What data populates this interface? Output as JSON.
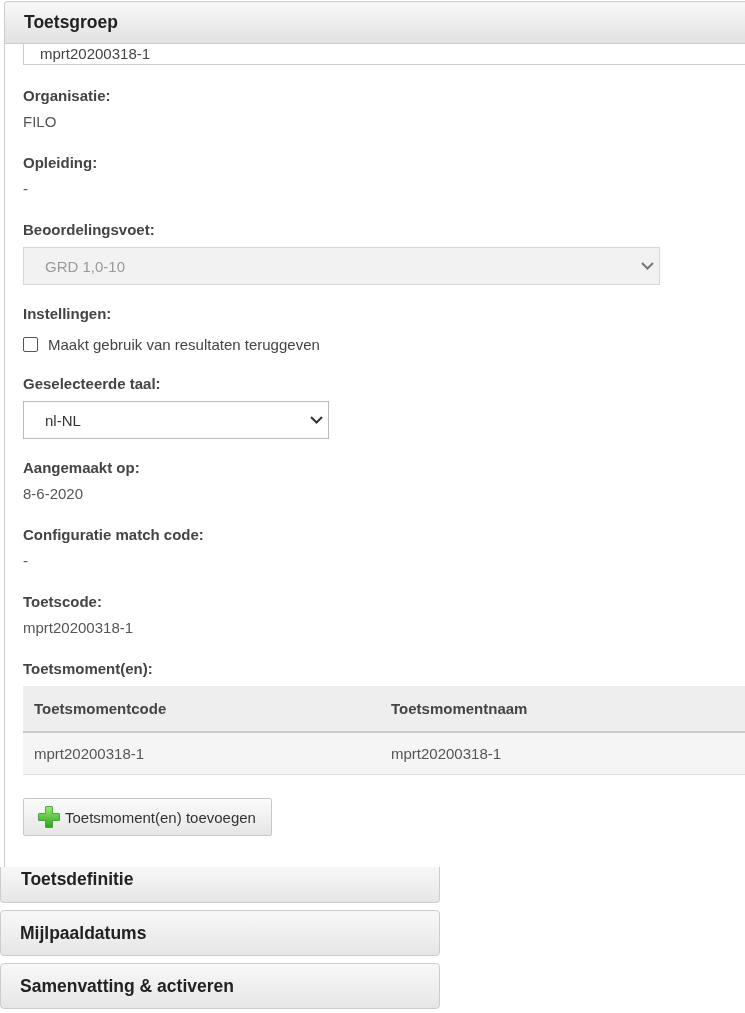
{
  "panel": {
    "title": "Toetsgroep",
    "name_field": {
      "value": "mprt20200318-1"
    },
    "fields": [
      {
        "kind": "text",
        "label": "Organisatie:",
        "value": "FILO"
      },
      {
        "kind": "text",
        "label": "Opleiding:",
        "value": "-"
      },
      {
        "kind": "select",
        "label": "Beoordelingsvoet:",
        "value": "GRD 1,0-10",
        "disabled": true
      },
      {
        "kind": "checkbox",
        "label": "Instellingen:",
        "option": "Maakt gebruik van resultaten teruggeven",
        "checked": false
      },
      {
        "kind": "select",
        "label": "Geselecteerde taal:",
        "value": "nl-NL",
        "disabled": false
      },
      {
        "kind": "text",
        "label": "Aangemaakt op:",
        "value": "8-6-2020"
      },
      {
        "kind": "text",
        "label": "Configuratie match code:",
        "value": "-"
      },
      {
        "kind": "text",
        "label": "Toetscode:",
        "value": "mprt20200318-1"
      },
      {
        "kind": "table",
        "label": "Toetsmoment(en):",
        "columns": [
          "Toetsmomentcode",
          "Toetsmomentnaam"
        ],
        "rows": [
          [
            "mprt20200318-1",
            "mprt20200318-1"
          ]
        ]
      }
    ],
    "add_button": {
      "label": "Toetsmoment(en) toevoegen"
    }
  },
  "sections": [
    {
      "title": "Toetsdefinitie"
    },
    {
      "title": "Mijlpaaldatums"
    },
    {
      "title": "Samenvatting & activeren"
    }
  ]
}
